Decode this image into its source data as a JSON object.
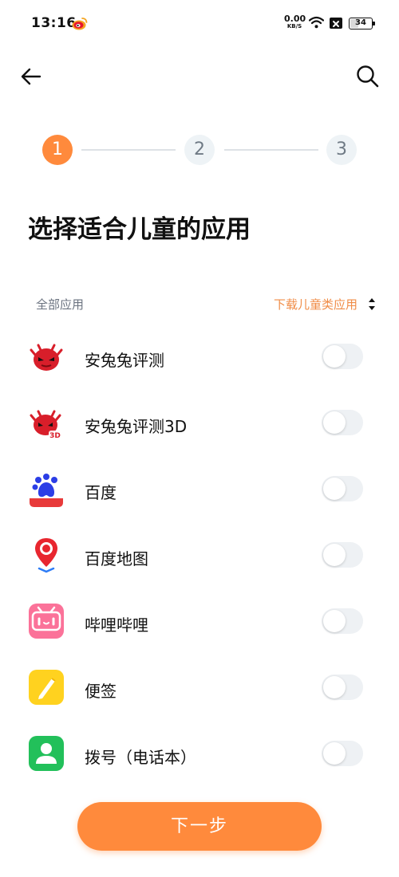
{
  "status_bar": {
    "time": "13:16",
    "net_speed_value": "0.00",
    "net_speed_unit": "KB/S",
    "battery_level": "34",
    "notification_icon": "weibo-icon"
  },
  "header": {
    "back_icon": "arrow-left-icon",
    "search_icon": "search-icon"
  },
  "stepper": {
    "steps": [
      {
        "label": "1",
        "active": true
      },
      {
        "label": "2",
        "active": false
      },
      {
        "label": "3",
        "active": false
      }
    ]
  },
  "page_title": "选择适合儿童的应用",
  "filter": {
    "all_apps_label": "全部应用",
    "dropdown_label": "下载儿童类应用"
  },
  "apps": [
    {
      "name": "安兔兔评测",
      "icon": "antutu-icon",
      "enabled": false
    },
    {
      "name": "安兔兔评测3D",
      "icon": "antutu-3d-icon",
      "enabled": false
    },
    {
      "name": "百度",
      "icon": "baidu-icon",
      "enabled": false
    },
    {
      "name": "百度地图",
      "icon": "baidu-map-icon",
      "enabled": false
    },
    {
      "name": "哔哩哔哩",
      "icon": "bilibili-icon",
      "enabled": false
    },
    {
      "name": "便签",
      "icon": "notes-icon",
      "enabled": false
    },
    {
      "name": "拨号（电话本）",
      "icon": "contacts-icon",
      "enabled": false
    }
  ],
  "next_button_label": "下一步",
  "colors": {
    "accent": "#ff8a3c",
    "toggle_off": "#eef1f4",
    "step_inactive": "#eef3f6"
  }
}
